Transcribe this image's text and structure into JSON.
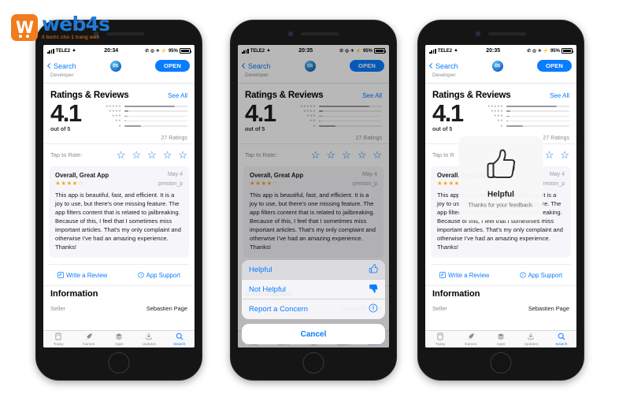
{
  "brand": {
    "mark_letter": "W",
    "name": "web4s",
    "tagline": "ô bước cho 1 trang web"
  },
  "status_bar": {
    "carrier": "TELE2",
    "battery_pct": "95%",
    "indicator_glyphs": "✆ ◎ ✈ ⚡"
  },
  "nav": {
    "back_label": "Search",
    "open_label": "OPEN",
    "developer_label": "Developer",
    "app_icon_text": "DS"
  },
  "ratings": {
    "section_title": "Ratings & Reviews",
    "see_all": "See All",
    "score": "4.1",
    "out_of": "out of 5",
    "count_label": "27 Ratings",
    "tap_to_rate_label": "Tap to Rate:",
    "tap_to_rate_short": "Tap to R",
    "star_glyph": "☆"
  },
  "histogram": {
    "rows": [
      {
        "stars": 5,
        "percent": 80
      },
      {
        "stars": 4,
        "percent": 6
      },
      {
        "stars": 3,
        "percent": 5
      },
      {
        "stars": 2,
        "percent": 3
      },
      {
        "stars": 1,
        "percent": 26
      }
    ]
  },
  "review": {
    "title": "Overall, Great App",
    "date": "May 4",
    "author": "preston_p",
    "stars_filled": "★★★★",
    "stars_empty": "☆",
    "body": "This app is beautiful, fast, and efficient. It is a joy to use, but there's one missing feature. The app filters content that is related to jailbreaking. Because of this, I feel that I sometimes miss important articles. That's my only complaint and otherwise I've had an amazing experience. Thanks!"
  },
  "actions": {
    "write_review": "Write a Review",
    "app_support": "App Support",
    "write_icon": "pencil-square-icon",
    "support_icon": "question-circle-icon"
  },
  "information": {
    "heading": "Information",
    "rows": [
      {
        "key": "Seller",
        "value": "Sebastien Page"
      }
    ]
  },
  "tabbar": {
    "items": [
      {
        "label": "Today",
        "icon": "today-icon",
        "glyph": "▭",
        "active": false
      },
      {
        "label": "Games",
        "icon": "rocket-icon",
        "glyph": "➤",
        "active": false
      },
      {
        "label": "Apps",
        "icon": "stack-icon",
        "glyph": "≡",
        "active": false
      },
      {
        "label": "Updates",
        "icon": "download-icon",
        "glyph": "⬇",
        "active": false
      },
      {
        "label": "Search",
        "icon": "search-icon",
        "glyph": "⌕",
        "active": true
      }
    ]
  },
  "action_sheet": {
    "items": [
      {
        "label": "Helpful",
        "icon": "thumbs-up-icon",
        "glyph": "👍",
        "highlighted": true
      },
      {
        "label": "Not Helpful",
        "icon": "thumbs-down-icon",
        "glyph": "👎",
        "highlighted": false
      },
      {
        "label": "Report a Concern",
        "icon": "exclamation-circle-icon",
        "glyph": "ⓘ",
        "highlighted": false
      }
    ],
    "cancel_label": "Cancel"
  },
  "toast": {
    "icon": "thumbs-up-icon",
    "title": "Helpful",
    "subtitle": "Thanks for your feedback."
  },
  "phones": [
    {
      "id": "phone-1",
      "time": "20:34",
      "overlay": "none"
    },
    {
      "id": "phone-2",
      "time": "20:35",
      "overlay": "action-sheet"
    },
    {
      "id": "phone-3",
      "time": "20:35",
      "overlay": "toast"
    }
  ],
  "colors": {
    "accent_blue": "#0a7cff",
    "brand_orange": "#f07c1e",
    "brand_blue": "#1f7bd6",
    "star_orange": "#f5a623"
  }
}
